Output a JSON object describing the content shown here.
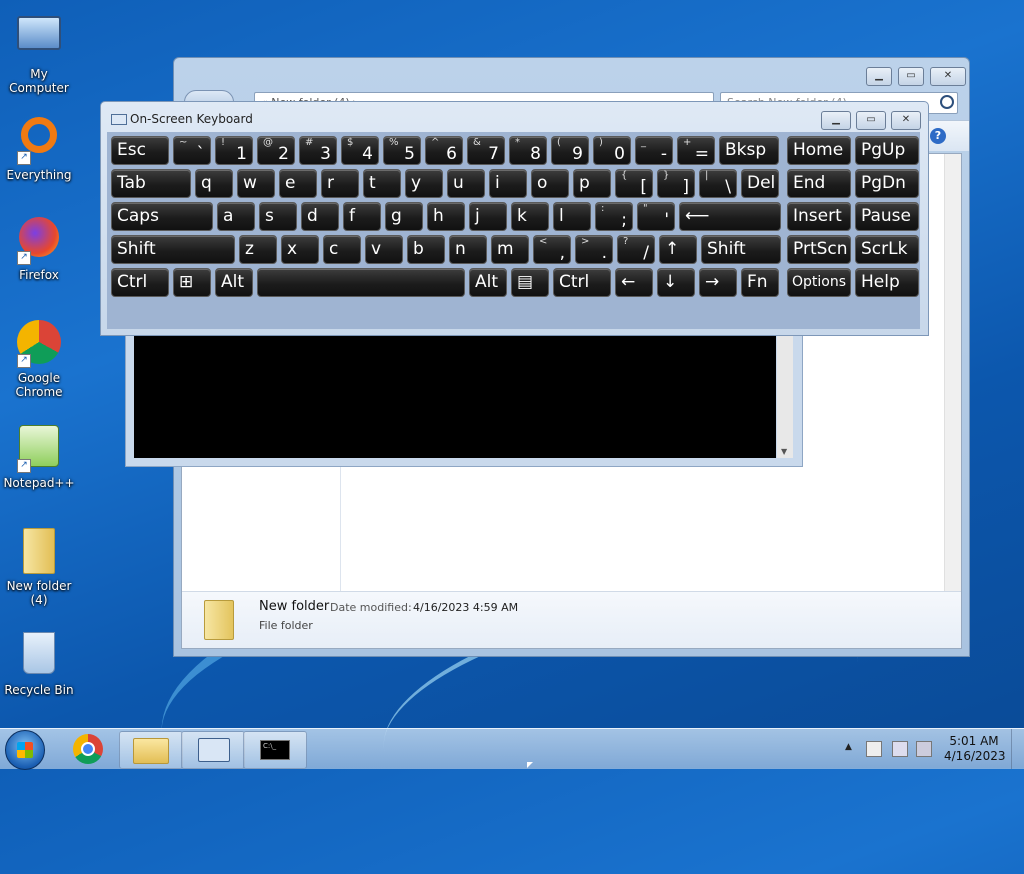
{
  "desktop": {
    "icons": [
      {
        "label": "My Computer"
      },
      {
        "label": "Everything"
      },
      {
        "label": "Firefox"
      },
      {
        "label": "Google Chrome"
      },
      {
        "label": "Notepad++"
      },
      {
        "label": "New folder (4)"
      },
      {
        "label": "Recycle Bin"
      }
    ]
  },
  "explorer": {
    "address_text": "« New folder (4) ▸",
    "search_placeholder": "Search New folder (4)",
    "file": {
      "name": "New folder",
      "date_label": "Date modified:",
      "date_value": "4/16/2023 4:59 AM",
      "type": "File folder"
    },
    "help_icon": "?"
  },
  "osk": {
    "title": "On-Screen Keyboard",
    "rows": [
      [
        {
          "w": 58,
          "lbl": "Esc"
        },
        {
          "w": 38,
          "sm": "~",
          "big": "`"
        },
        {
          "w": 38,
          "sm": "!",
          "big": "1"
        },
        {
          "w": 38,
          "sm": "@",
          "big": "2"
        },
        {
          "w": 38,
          "sm": "#",
          "big": "3"
        },
        {
          "w": 38,
          "sm": "$",
          "big": "4"
        },
        {
          "w": 38,
          "sm": "%",
          "big": "5"
        },
        {
          "w": 38,
          "sm": "^",
          "big": "6"
        },
        {
          "w": 38,
          "sm": "&",
          "big": "7"
        },
        {
          "w": 38,
          "sm": "*",
          "big": "8"
        },
        {
          "w": 38,
          "sm": "(",
          "big": "9"
        },
        {
          "w": 38,
          "sm": ")",
          "big": "0"
        },
        {
          "w": 38,
          "sm": "_",
          "big": "-"
        },
        {
          "w": 38,
          "sm": "+",
          "big": "="
        },
        {
          "w": 60,
          "lbl": "Bksp"
        }
      ],
      [
        {
          "w": 80,
          "lbl": "Tab"
        },
        {
          "w": 38,
          "lbl": "q"
        },
        {
          "w": 38,
          "lbl": "w"
        },
        {
          "w": 38,
          "lbl": "e"
        },
        {
          "w": 38,
          "lbl": "r"
        },
        {
          "w": 38,
          "lbl": "t"
        },
        {
          "w": 38,
          "lbl": "y"
        },
        {
          "w": 38,
          "lbl": "u"
        },
        {
          "w": 38,
          "lbl": "i"
        },
        {
          "w": 38,
          "lbl": "o"
        },
        {
          "w": 38,
          "lbl": "p"
        },
        {
          "w": 38,
          "sm": "{",
          "big": "["
        },
        {
          "w": 38,
          "sm": "}",
          "big": "]"
        },
        {
          "w": 38,
          "sm": "|",
          "big": "\\"
        },
        {
          "w": 38,
          "lbl": "Del"
        }
      ],
      [
        {
          "w": 102,
          "lbl": "Caps"
        },
        {
          "w": 38,
          "lbl": "a"
        },
        {
          "w": 38,
          "lbl": "s"
        },
        {
          "w": 38,
          "lbl": "d"
        },
        {
          "w": 38,
          "lbl": "f"
        },
        {
          "w": 38,
          "lbl": "g"
        },
        {
          "w": 38,
          "lbl": "h"
        },
        {
          "w": 38,
          "lbl": "j"
        },
        {
          "w": 38,
          "lbl": "k"
        },
        {
          "w": 38,
          "lbl": "l"
        },
        {
          "w": 38,
          "sm": ":",
          "big": ";"
        },
        {
          "w": 38,
          "sm": "\"",
          "big": "'"
        },
        {
          "w": 102,
          "lbl": "⟵"
        }
      ],
      [
        {
          "w": 124,
          "lbl": "Shift"
        },
        {
          "w": 38,
          "lbl": "z"
        },
        {
          "w": 38,
          "lbl": "x"
        },
        {
          "w": 38,
          "lbl": "c"
        },
        {
          "w": 38,
          "lbl": "v"
        },
        {
          "w": 38,
          "lbl": "b"
        },
        {
          "w": 38,
          "lbl": "n"
        },
        {
          "w": 38,
          "lbl": "m"
        },
        {
          "w": 38,
          "sm": "<",
          "big": ","
        },
        {
          "w": 38,
          "sm": ">",
          "big": "."
        },
        {
          "w": 38,
          "sm": "?",
          "big": "/"
        },
        {
          "w": 38,
          "lbl": "↑"
        },
        {
          "w": 80,
          "lbl": "Shift"
        }
      ],
      [
        {
          "w": 58,
          "lbl": "Ctrl"
        },
        {
          "w": 38,
          "lbl": "⊞"
        },
        {
          "w": 38,
          "lbl": "Alt"
        },
        {
          "w": 208,
          "lbl": ""
        },
        {
          "w": 38,
          "lbl": "Alt"
        },
        {
          "w": 38,
          "lbl": "▤"
        },
        {
          "w": 58,
          "lbl": "Ctrl"
        },
        {
          "w": 38,
          "lbl": "←"
        },
        {
          "w": 38,
          "lbl": "↓"
        },
        {
          "w": 38,
          "lbl": "→"
        },
        {
          "w": 38,
          "lbl": "Fn"
        }
      ]
    ],
    "nav_keys": [
      [
        "Home",
        "PgUp"
      ],
      [
        "End",
        "PgDn"
      ],
      [
        "Insert",
        "Pause"
      ],
      [
        "PrtScn",
        "ScrLk"
      ],
      [
        "Options",
        "Help"
      ]
    ]
  },
  "taskbar": {
    "time": "5:01 AM",
    "date": "4/16/2023",
    "tray_chevron": "▲"
  }
}
